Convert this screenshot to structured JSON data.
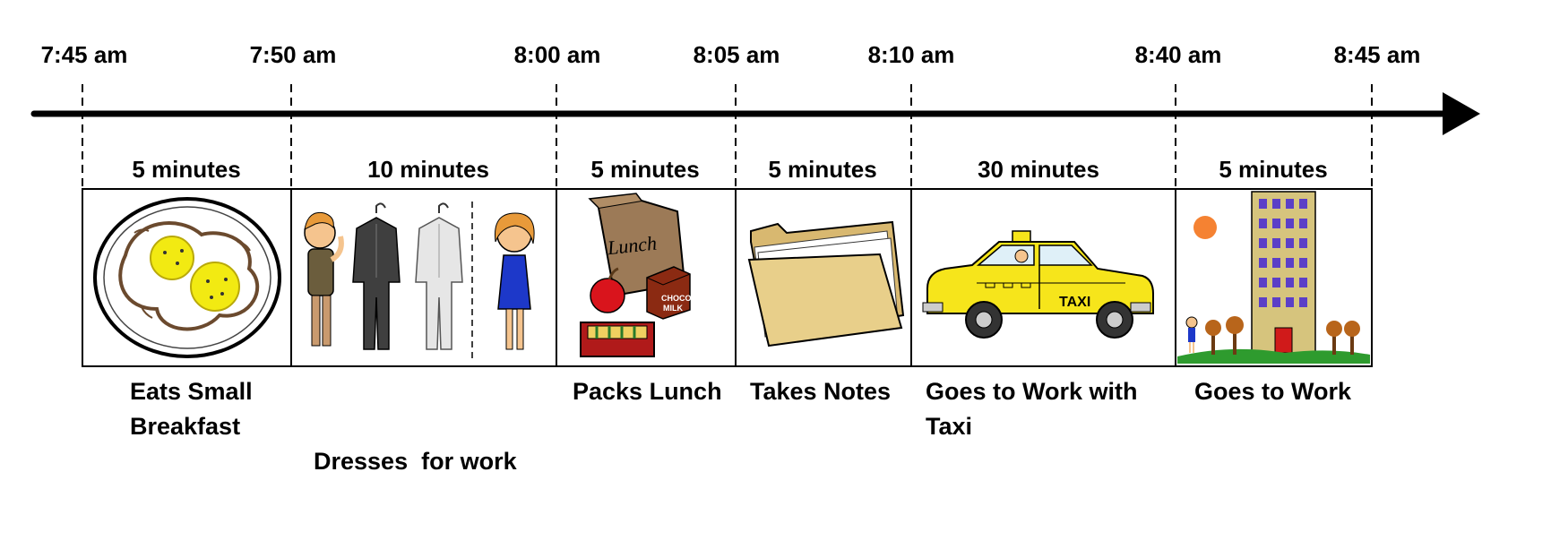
{
  "timeline": {
    "times": [
      "7:45 am",
      "7:50 am",
      "8:00 am",
      "8:05 am",
      "8:10 am",
      "8:40 am",
      "8:45 am"
    ],
    "segments": [
      {
        "duration": "5 minutes",
        "label_lines": [
          "Eats Small",
          "Breakfast"
        ],
        "icon": "fried-eggs-plate-icon"
      },
      {
        "duration": "10 minutes",
        "label_lines": [
          "Dresses  for work"
        ],
        "icon": "dressing-clothes-icon"
      },
      {
        "duration": "5 minutes",
        "label_lines": [
          "Packs Lunch"
        ],
        "icon": "lunch-bag-icon"
      },
      {
        "duration": "5 minutes",
        "label_lines": [
          "Takes Notes"
        ],
        "icon": "folder-icon"
      },
      {
        "duration": "30 minutes",
        "label_lines": [
          "Goes to Work with",
          "Taxi"
        ],
        "icon": "taxi-icon"
      },
      {
        "duration": "5 minutes",
        "label_lines": [
          "Goes to Work"
        ],
        "icon": "office-building-icon"
      }
    ]
  },
  "colors": {
    "line": "#000000",
    "egg_yolk": "#f2ea12",
    "taxi": "#f6e51b",
    "folder": "#e8cf8a",
    "building": "#d6c47d",
    "windows": "#5b3fc7",
    "sun": "#f58232",
    "bag": "#9c7a57",
    "apple": "#d9141c",
    "dress": "#1d38c9",
    "door": "#d01a1a"
  },
  "taxi_sign": "TAXI",
  "lunch_bag_text": "Lunch",
  "milk_text": [
    "CHOCO",
    "MILK"
  ]
}
